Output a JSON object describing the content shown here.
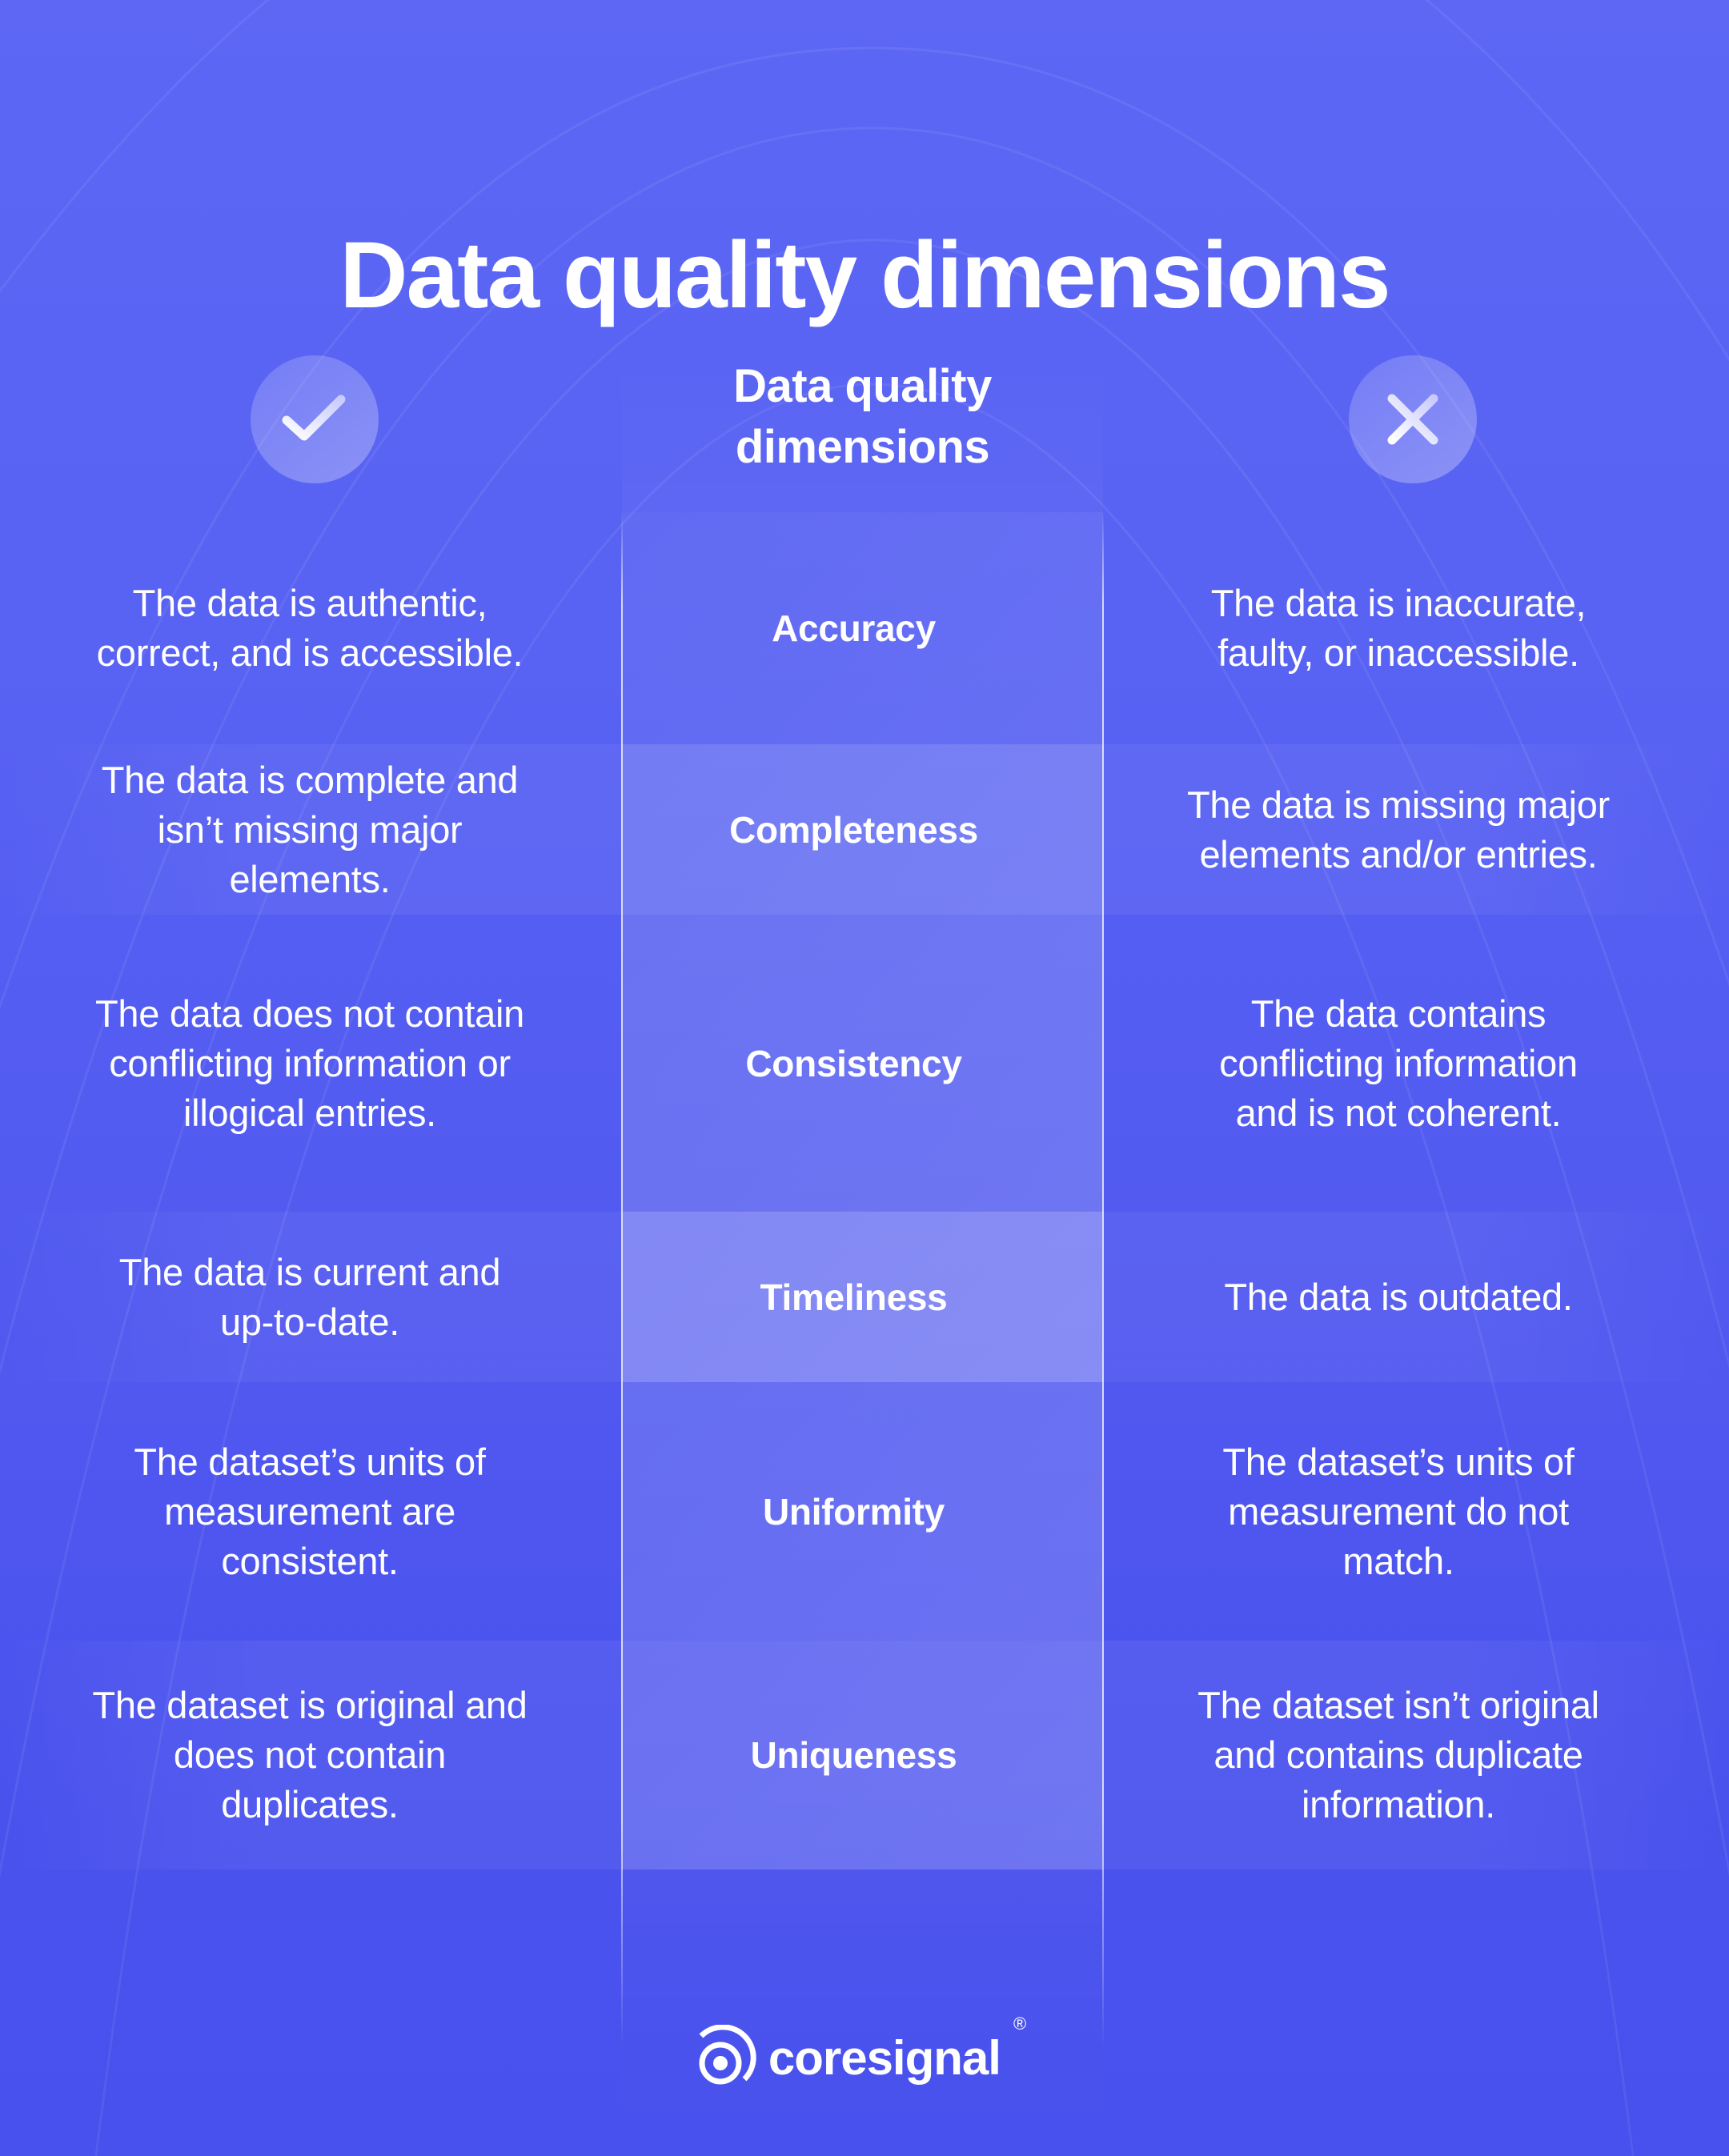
{
  "title": "Data quality dimensions",
  "columns": {
    "good_icon": "check-icon",
    "header": [
      "Data quality",
      "dimensions"
    ],
    "bad_icon": "close-icon"
  },
  "rows": [
    {
      "dimension": "Accuracy",
      "good": [
        "The data is authentic,",
        "correct, and is accessible."
      ],
      "bad": [
        "The data is inaccurate,",
        "faulty, or inaccessible."
      ]
    },
    {
      "dimension": "Completeness",
      "good": [
        "The data is complete and",
        "isn’t missing major",
        "elements."
      ],
      "bad": [
        "The data is missing major",
        "elements and/or entries."
      ]
    },
    {
      "dimension": "Consistency",
      "good": [
        "The data does not contain",
        "conflicting information or",
        "illogical entries."
      ],
      "bad": [
        "The data contains",
        "conflicting information",
        "and is not coherent."
      ]
    },
    {
      "dimension": "Timeliness",
      "good": [
        "The data is current and",
        "up-to-date."
      ],
      "bad": [
        "The data is outdated."
      ]
    },
    {
      "dimension": "Uniformity",
      "good": [
        "The dataset’s units of",
        "measurement are",
        "consistent."
      ],
      "bad": [
        "The dataset’s units of",
        "measurement do not",
        "match."
      ]
    },
    {
      "dimension": "Uniqueness",
      "good": [
        "The dataset is original and",
        "does not contain",
        "duplicates."
      ],
      "bad": [
        "The dataset isn’t original",
        "and contains duplicate",
        "information."
      ]
    }
  ],
  "brand": {
    "name": "coresignal",
    "registered_mark": "®",
    "logo_icon": "coresignal-logo-icon"
  },
  "colors": {
    "background_top": "#5d67f4",
    "background_bottom": "#4850ed",
    "text": "#ffffff"
  }
}
